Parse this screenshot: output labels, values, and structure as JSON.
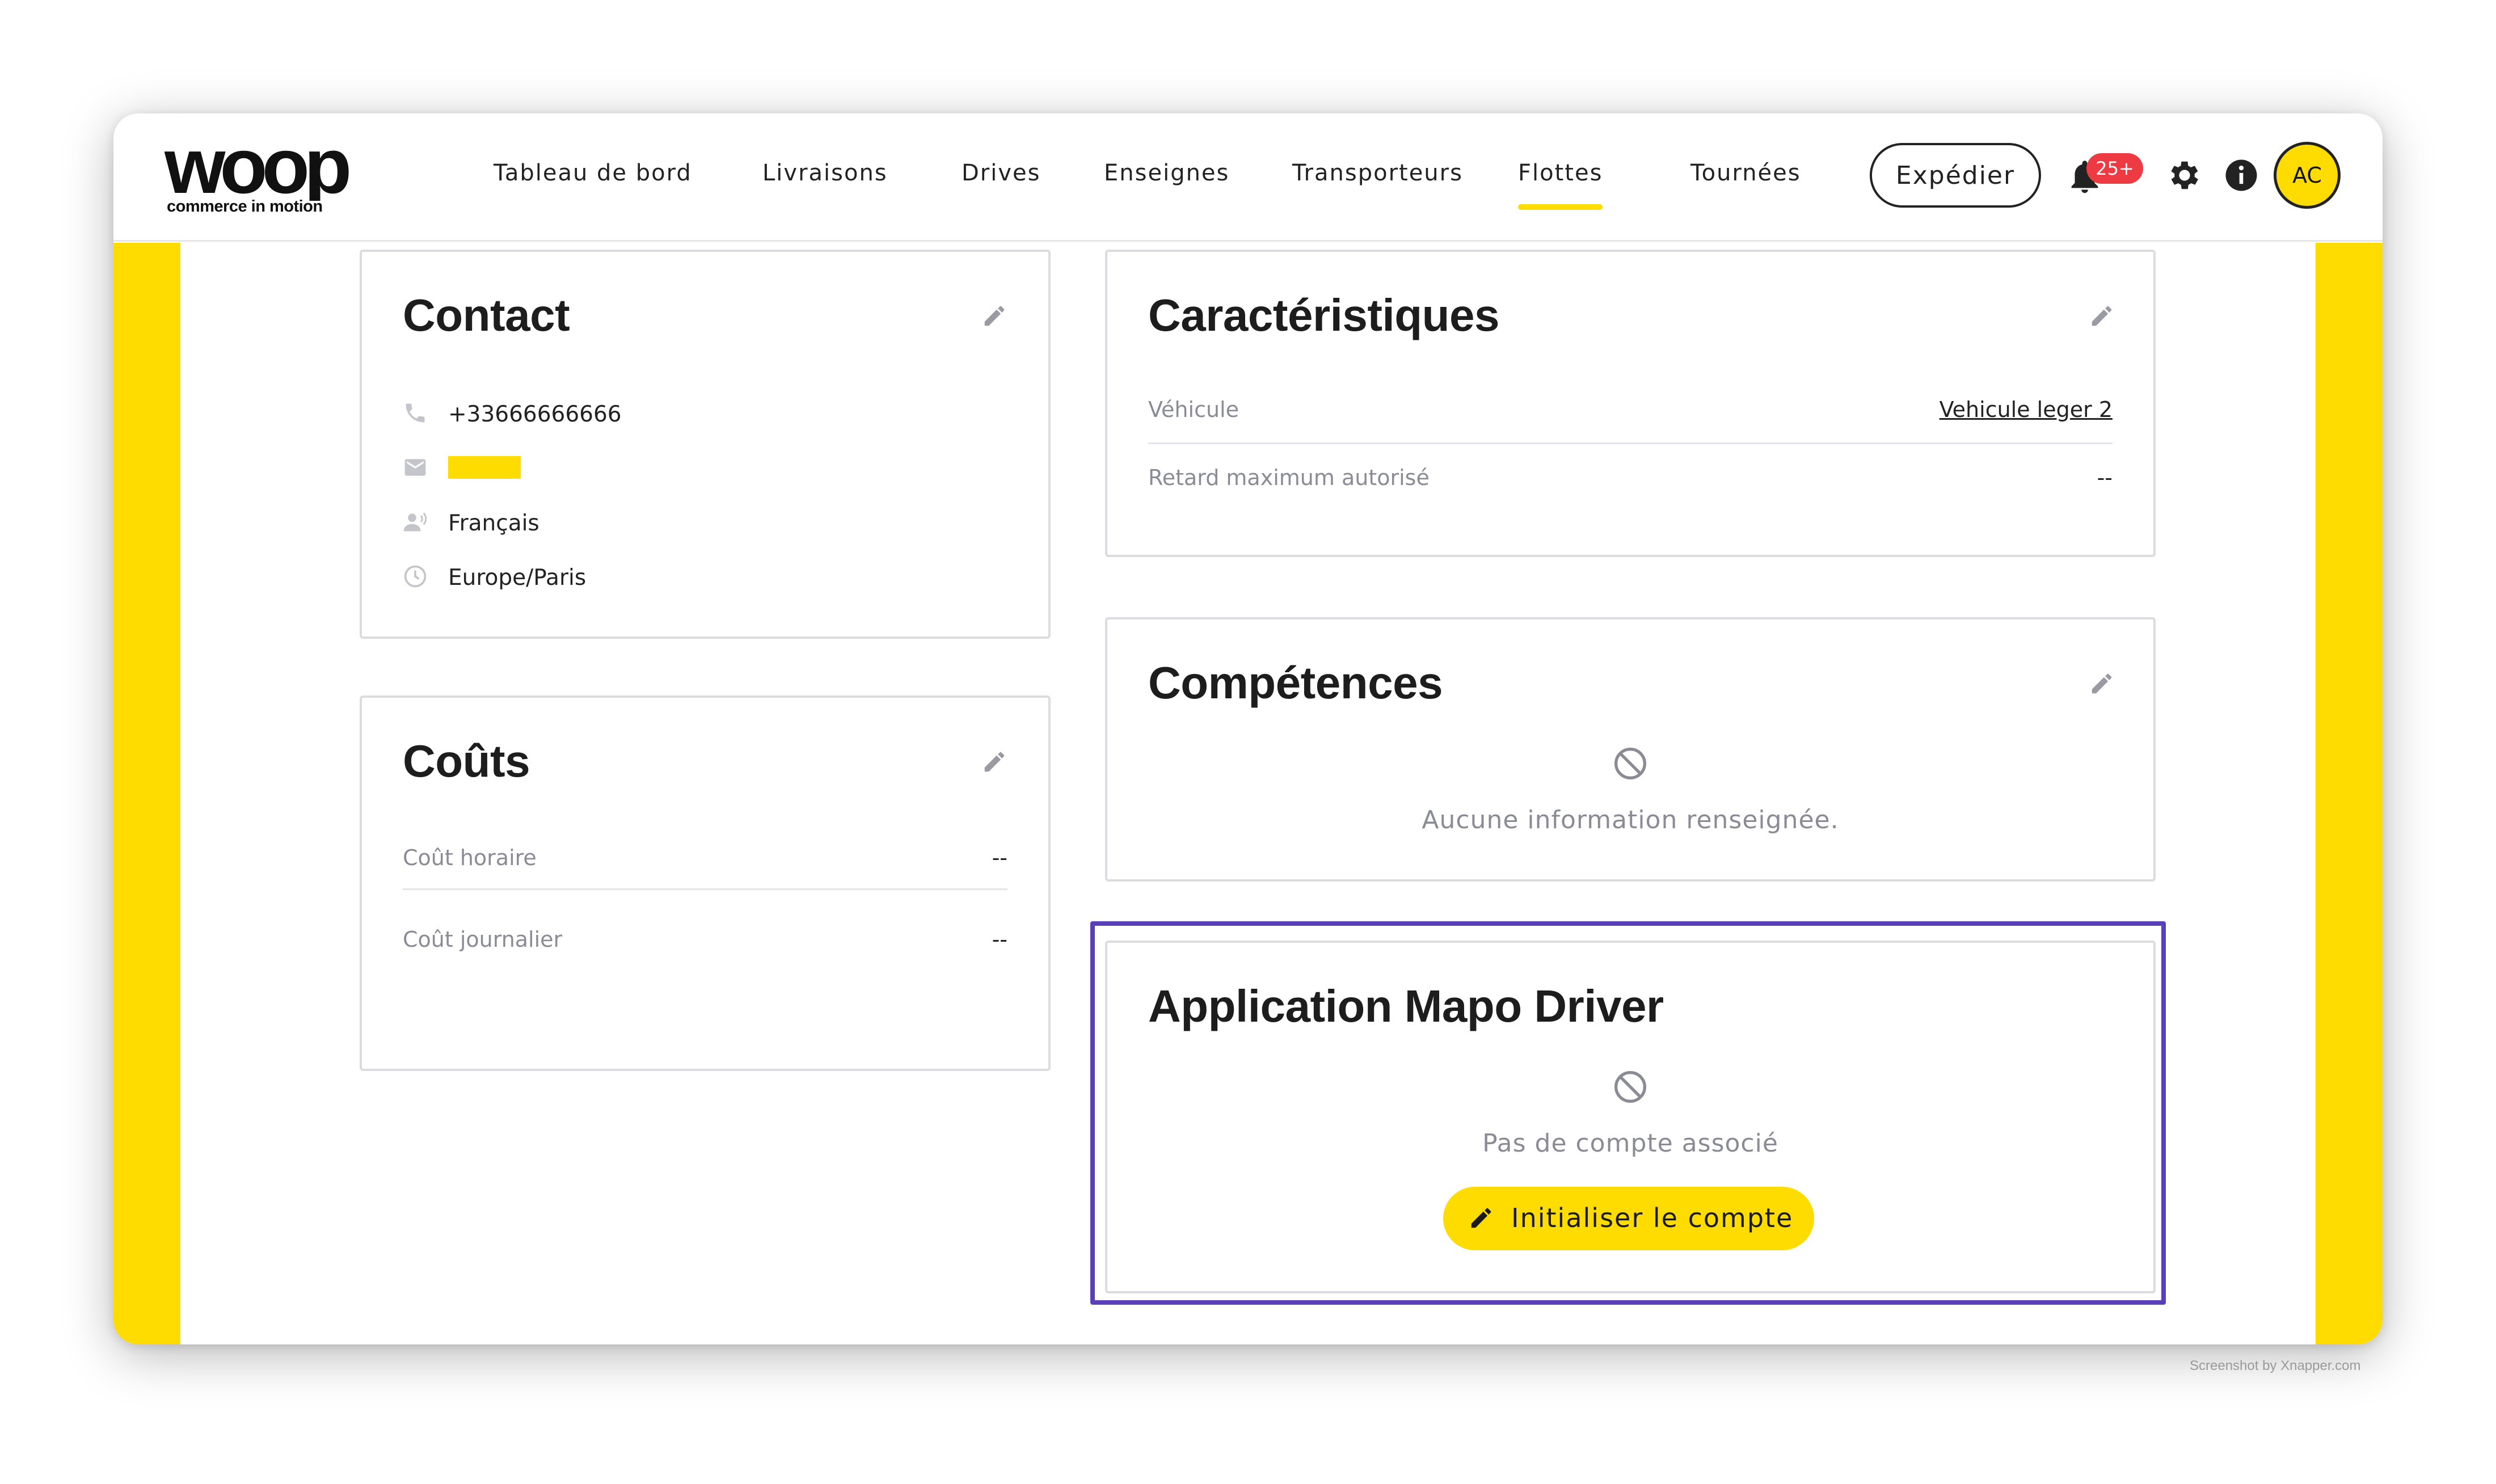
{
  "app": {
    "logo_word": "woop",
    "logo_tagline": "commerce in motion"
  },
  "nav": {
    "items": [
      {
        "label": "Tableau de bord",
        "active": false
      },
      {
        "label": "Livraisons",
        "active": false
      },
      {
        "label": "Drives",
        "active": false
      },
      {
        "label": "Enseignes",
        "active": false
      },
      {
        "label": "Transporteurs",
        "active": false
      },
      {
        "label": "Flottes",
        "active": true
      },
      {
        "label": "Tournées",
        "active": false
      }
    ],
    "ship_button": "Expédier",
    "notification_badge": "25+",
    "avatar_initials": "AC"
  },
  "contact": {
    "title": "Contact",
    "phone": "+33666666666",
    "language": "Français",
    "timezone": "Europe/Paris"
  },
  "costs": {
    "title": "Coûts",
    "rows": [
      {
        "label": "Coût horaire",
        "value": "--"
      },
      {
        "label": "Coût journalier",
        "value": "--"
      }
    ]
  },
  "characteristics": {
    "title": "Caractéristiques",
    "rows": [
      {
        "label": "Véhicule",
        "value": "Vehicule leger 2"
      },
      {
        "label": "Retard maximum autorisé",
        "value": "--"
      }
    ]
  },
  "skills": {
    "title": "Compétences",
    "empty_text": "Aucune information renseignée."
  },
  "driver_app": {
    "title": "Application Mapo Driver",
    "empty_text": "Pas de compte associé",
    "init_button": "Initialiser le compte"
  },
  "watermark": "Screenshot by Xnapper.com",
  "colors": {
    "brand_yellow": "#ffdc00",
    "highlight": "#5940b8",
    "badge_red": "#ee3a43",
    "muted_text": "#8b8b96"
  },
  "icons": {
    "phone": "phone-icon",
    "mail": "mail-icon",
    "language": "language-icon",
    "timezone": "clock-icon",
    "edit": "pencil-icon",
    "empty": "block-icon",
    "notifications": "bell-icon",
    "settings": "gear-icon",
    "info": "info-icon"
  }
}
